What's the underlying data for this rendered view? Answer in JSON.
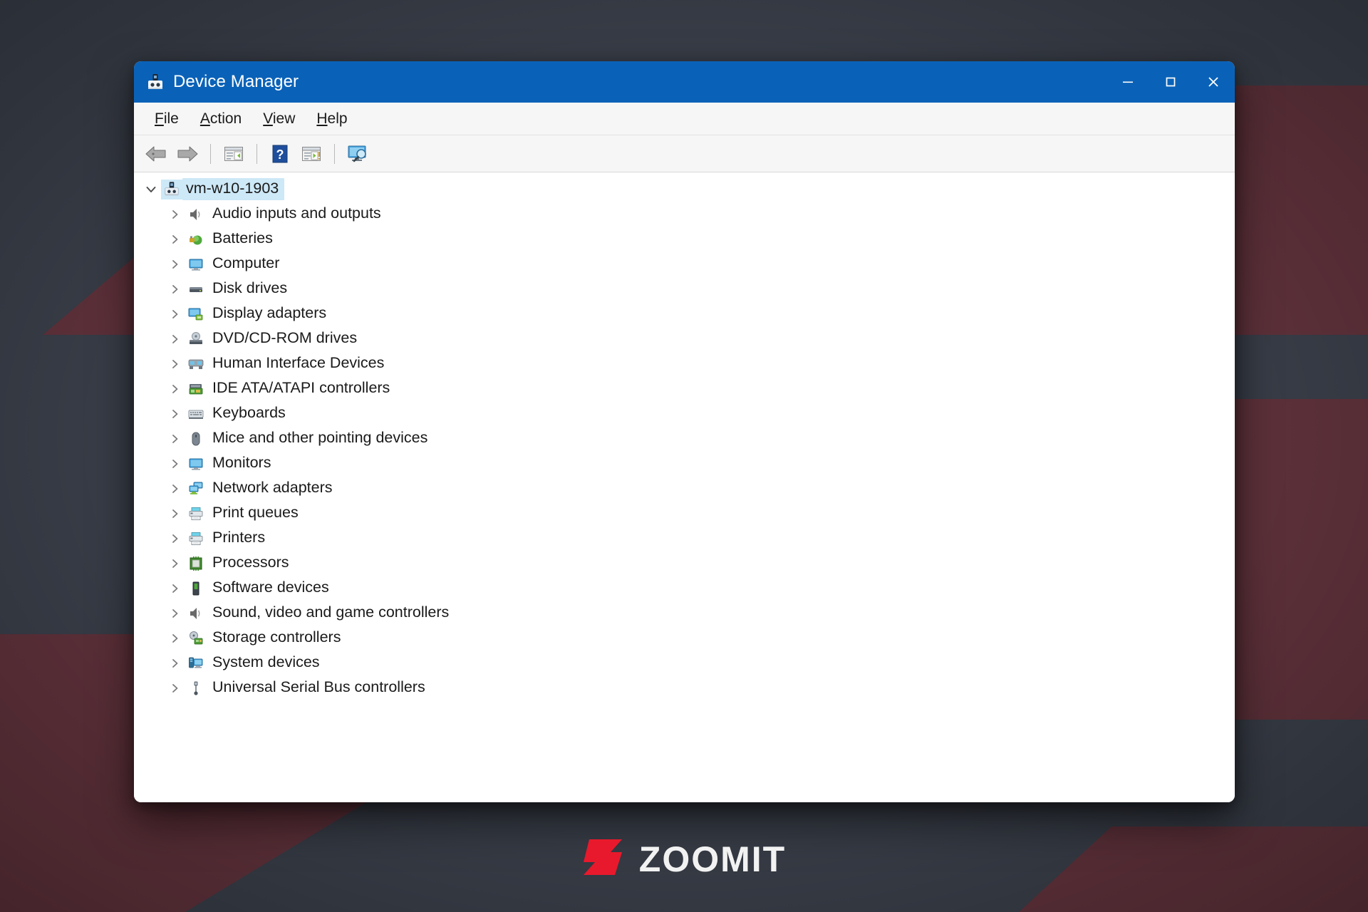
{
  "window": {
    "title": "Device Manager",
    "icon": "device-manager-icon",
    "accent_color": "#0a62b8",
    "controls": [
      {
        "name": "minimize",
        "glyph": "minimize-icon"
      },
      {
        "name": "maximize",
        "glyph": "maximize-icon"
      },
      {
        "name": "close",
        "glyph": "close-icon"
      }
    ]
  },
  "menubar": {
    "items": [
      {
        "label": "File",
        "accesskey": "F",
        "rest": "ile"
      },
      {
        "label": "Action",
        "accesskey": "A",
        "rest": "ction"
      },
      {
        "label": "View",
        "accesskey": "V",
        "rest": "iew"
      },
      {
        "label": "Help",
        "accesskey": "H",
        "rest": "elp"
      }
    ]
  },
  "toolbar": {
    "buttons": [
      {
        "name": "back-button",
        "icon": "back-arrow-icon",
        "tooltip": "Back"
      },
      {
        "name": "forward-button",
        "icon": "forward-arrow-icon",
        "tooltip": "Forward"
      },
      {
        "name": "separator-1",
        "icon": "separator"
      },
      {
        "name": "properties-button",
        "icon": "properties-icon",
        "tooltip": "Properties"
      },
      {
        "name": "separator-2",
        "icon": "separator"
      },
      {
        "name": "help-button",
        "icon": "help-question-icon",
        "tooltip": "Help"
      },
      {
        "name": "update-driver-button",
        "icon": "update-driver-icon",
        "tooltip": "Update driver"
      },
      {
        "name": "separator-3",
        "icon": "separator"
      },
      {
        "name": "scan-hardware-button",
        "icon": "scan-hardware-icon",
        "tooltip": "Scan for hardware changes"
      }
    ]
  },
  "tree": {
    "root": {
      "label": "vm-w10-1903",
      "icon": "computer-root-icon",
      "expanded": true,
      "selected": true,
      "selection_color": "#cde8f7"
    },
    "children": [
      {
        "label": "Audio inputs and outputs",
        "icon": "speaker-icon"
      },
      {
        "label": "Batteries",
        "icon": "battery-icon"
      },
      {
        "label": "Computer",
        "icon": "monitor-icon"
      },
      {
        "label": "Disk drives",
        "icon": "disk-drive-icon"
      },
      {
        "label": "Display adapters",
        "icon": "display-adapter-icon"
      },
      {
        "label": "DVD/CD-ROM drives",
        "icon": "dvd-drive-icon"
      },
      {
        "label": "Human Interface Devices",
        "icon": "hid-icon"
      },
      {
        "label": "IDE ATA/ATAPI controllers",
        "icon": "ide-controller-icon"
      },
      {
        "label": "Keyboards",
        "icon": "keyboard-icon"
      },
      {
        "label": "Mice and other pointing devices",
        "icon": "mouse-icon"
      },
      {
        "label": "Monitors",
        "icon": "monitor-icon"
      },
      {
        "label": "Network adapters",
        "icon": "network-adapter-icon"
      },
      {
        "label": "Print queues",
        "icon": "printer-icon"
      },
      {
        "label": "Printers",
        "icon": "printer-icon"
      },
      {
        "label": "Processors",
        "icon": "processor-icon"
      },
      {
        "label": "Software devices",
        "icon": "software-device-icon"
      },
      {
        "label": "Sound, video and game controllers",
        "icon": "speaker-icon"
      },
      {
        "label": "Storage controllers",
        "icon": "storage-controller-icon"
      },
      {
        "label": "System devices",
        "icon": "system-device-icon"
      },
      {
        "label": "Universal Serial Bus controllers",
        "icon": "usb-icon"
      }
    ]
  },
  "watermark": {
    "text": "ZOOMIT",
    "mark": "zoomit-z-logo",
    "mark_color": "#e8192c",
    "text_color": "#f2f2f2"
  },
  "background": {
    "base_color": "#373c46",
    "accent_color": "#5c3039"
  }
}
